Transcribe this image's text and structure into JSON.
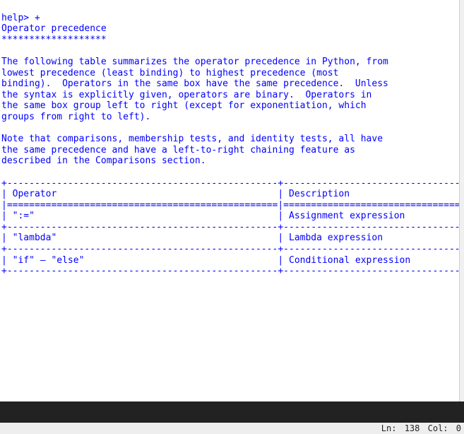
{
  "prompt": "help> +",
  "title": "Operator precedence",
  "underline": "*******************",
  "para1": "The following table summarizes the operator precedence in Python, from\nlowest precedence (least binding) to highest precedence (most\nbinding).  Operators in the same box have the same precedence.  Unless\nthe syntax is explicitly given, operators are binary.  Operators in\nthe same box group left to right (except for exponentiation, which\ngroups from right to left).",
  "para2": "Note that comparisons, membership tests, and identity tests, all have\nthe same precedence and have a left-to-right chaining feature as\ndescribed in the Comparisons section.",
  "table": {
    "hline": "+-------------------------------------------------+---------------------------------------+",
    "header": "| Operator                                        | Description                           |",
    "dline": "|=================================================|=======================================|",
    "row1": "| \":=\"                                            | Assignment expression                 |",
    "row2": "| \"lambda\"                                        | Lambda expression                     |",
    "row3": "| \"if\" – \"else\"                                   | Conditional expression                |"
  },
  "footer": {
    "line_label": "Ln:",
    "line_value": "138",
    "col_label": "Col:",
    "col_value": "0"
  }
}
